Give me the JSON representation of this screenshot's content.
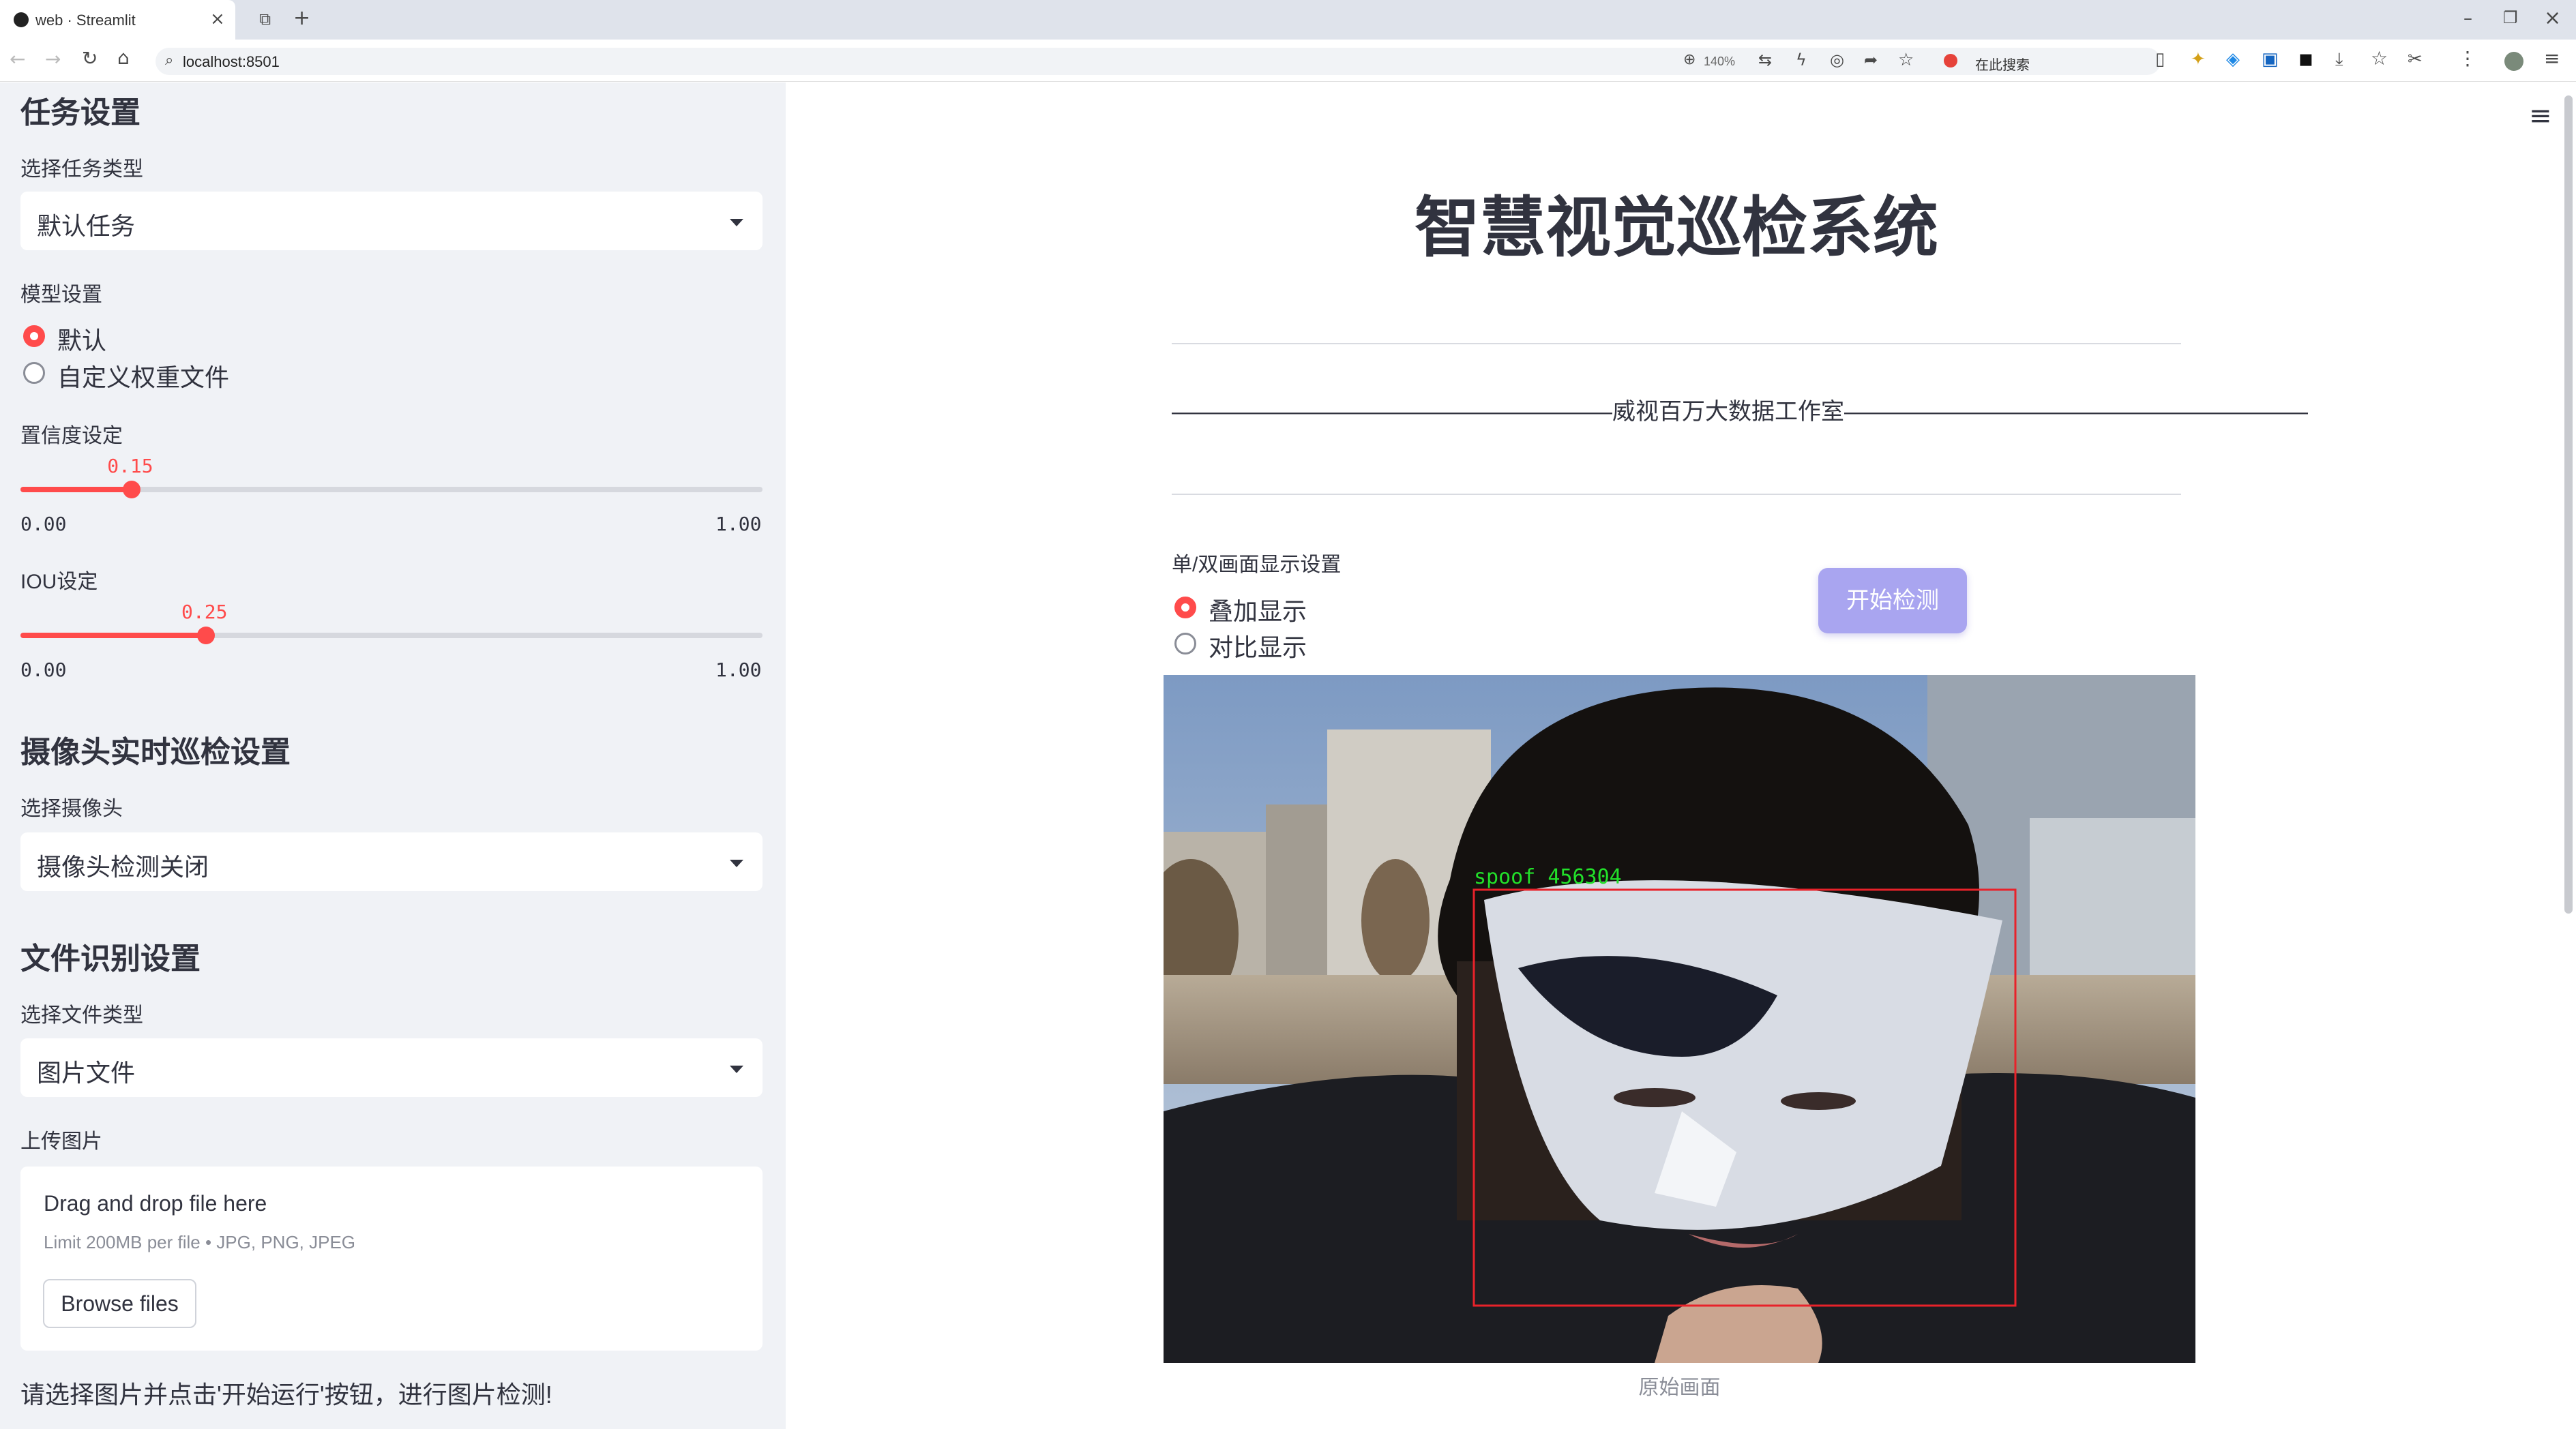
{
  "browser": {
    "tab_title": "web · Streamlit",
    "url": "localhost:8501",
    "zoom": "140%",
    "search_placeholder": "在此搜索"
  },
  "sidebar": {
    "task_section": {
      "heading": "任务设置",
      "task_type_label": "选择任务类型",
      "task_type_value": "默认任务"
    },
    "model_section": {
      "label": "模型设置",
      "options": [
        "默认",
        "自定义权重文件"
      ],
      "selected": "默认"
    },
    "confidence": {
      "label": "置信度设定",
      "value": "0.15",
      "min": "0.00",
      "max": "1.00",
      "fraction": 0.15
    },
    "iou": {
      "label": "IOU设定",
      "value": "0.25",
      "min": "0.00",
      "max": "1.00",
      "fraction": 0.25
    },
    "camera_section": {
      "heading": "摄像头实时巡检设置",
      "label": "选择摄像头",
      "value": "摄像头检测关闭"
    },
    "file_section": {
      "heading": "文件识别设置",
      "file_type_label": "选择文件类型",
      "file_type_value": "图片文件",
      "upload_label": "上传图片",
      "drop_text": "Drag and drop file here",
      "limit_text": "Limit 200MB per file • JPG, PNG, JPEG",
      "browse_label": "Browse files"
    },
    "hint": "请选择图片并点击'开始运行'按钮，进行图片检测!"
  },
  "main": {
    "title": "智慧视觉巡检系统",
    "subtitle": "———————————————————威视百万大数据工作室————————————————————",
    "display_label": "单/双画面显示设置",
    "display_options": [
      "叠加显示",
      "对比显示"
    ],
    "display_selected": "叠加显示",
    "start_button": "开始检测",
    "detection_label": "spoof 456304",
    "image_caption": "原始画面"
  },
  "colors": {
    "accent": "#ff4b4b",
    "primary_button": "#a9a5f0",
    "detection_box": "#e8222a",
    "detection_text": "#22e02a",
    "sidebar_bg": "#f0f2f6"
  }
}
